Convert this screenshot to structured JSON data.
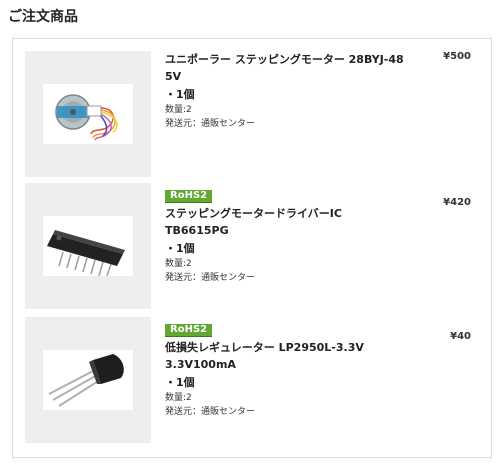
{
  "page": {
    "title": "ご注文商品"
  },
  "items": [
    {
      "badge": "",
      "name": "ユニポーラー ステッピングモーター 28BYJ-48 5V",
      "qty_label": "・1個",
      "quantity_text": "数量:2",
      "ship_from": "発送元：通販センター",
      "price": "¥500",
      "image_icon": "stepper-motor-icon"
    },
    {
      "badge": "RoHS2",
      "name": "ステッピングモータードライバーIC TB6615PG",
      "qty_label": "・1個",
      "quantity_text": "数量:2",
      "ship_from": "発送元：通販センター",
      "price": "¥420",
      "image_icon": "dip-ic-icon"
    },
    {
      "badge": "RoHS2",
      "name": "低損失レギュレーター LP2950L-3.3V 3.3V100mA",
      "qty_label": "・1個",
      "quantity_text": "数量:2",
      "ship_from": "発送元：通販センター",
      "price": "¥40",
      "image_icon": "to92-regulator-icon"
    }
  ]
}
